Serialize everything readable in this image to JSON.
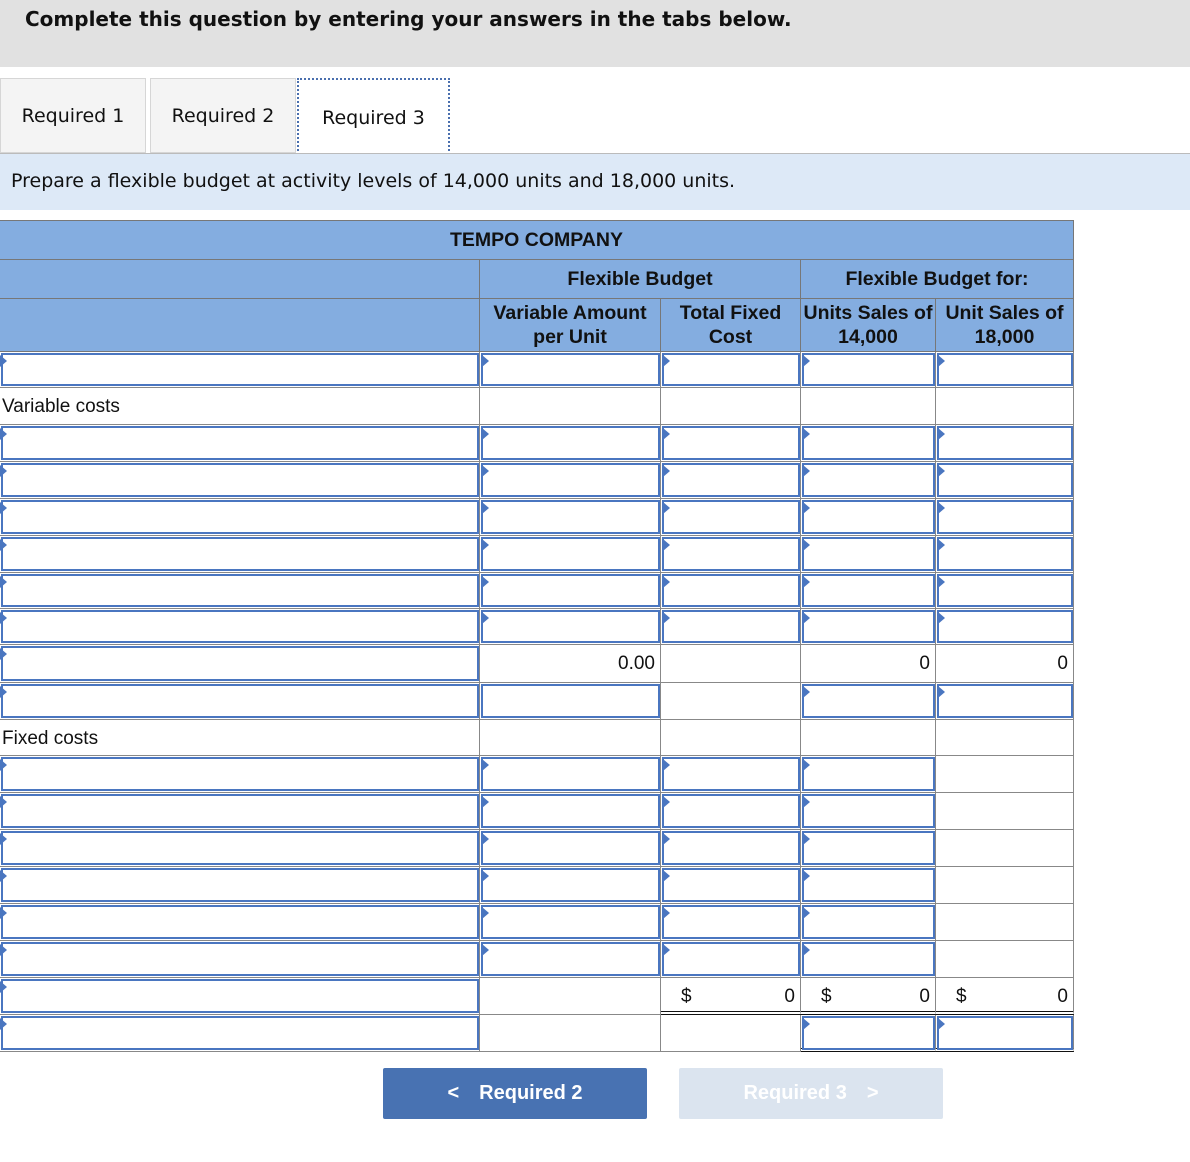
{
  "header": {
    "instruction": "Complete this question by entering your answers in the tabs below."
  },
  "tabs": [
    {
      "label": "Required 1"
    },
    {
      "label": "Required 2"
    },
    {
      "label": "Required 3",
      "active": true
    }
  ],
  "prompt": "Prepare a flexible budget at activity levels of 14,000 units and 18,000 units.",
  "table": {
    "company": "TEMPO COMPANY",
    "group1": "Flexible Budget",
    "group2": "Flexible Budget for:",
    "columns": [
      "Variable Amount per Unit",
      "Total Fixed Cost",
      "Units Sales of 14,000",
      "Unit Sales of 18,000"
    ],
    "rows": [
      {
        "label": {
          "t": "input"
        },
        "cells": [
          {
            "t": "input"
          },
          {
            "t": "input"
          },
          {
            "t": "input"
          },
          {
            "t": "input"
          }
        ]
      },
      {
        "label": {
          "t": "text",
          "v": "Variable costs"
        },
        "cells": [
          {
            "t": "blank"
          },
          {
            "t": "blank"
          },
          {
            "t": "blank"
          },
          {
            "t": "blank"
          }
        ]
      },
      {
        "label": {
          "t": "input"
        },
        "cells": [
          {
            "t": "input"
          },
          {
            "t": "input"
          },
          {
            "t": "input"
          },
          {
            "t": "input"
          }
        ]
      },
      {
        "label": {
          "t": "input"
        },
        "cells": [
          {
            "t": "input"
          },
          {
            "t": "input"
          },
          {
            "t": "input"
          },
          {
            "t": "input"
          }
        ]
      },
      {
        "label": {
          "t": "input"
        },
        "cells": [
          {
            "t": "input"
          },
          {
            "t": "input"
          },
          {
            "t": "input"
          },
          {
            "t": "input"
          }
        ]
      },
      {
        "label": {
          "t": "input"
        },
        "cells": [
          {
            "t": "input"
          },
          {
            "t": "input"
          },
          {
            "t": "input"
          },
          {
            "t": "input"
          }
        ]
      },
      {
        "label": {
          "t": "input"
        },
        "cells": [
          {
            "t": "input"
          },
          {
            "t": "input"
          },
          {
            "t": "input"
          },
          {
            "t": "input"
          }
        ]
      },
      {
        "label": {
          "t": "input"
        },
        "cells": [
          {
            "t": "input"
          },
          {
            "t": "input"
          },
          {
            "t": "input"
          },
          {
            "t": "input"
          }
        ]
      },
      {
        "label": {
          "t": "input"
        },
        "cells": [
          {
            "t": "value",
            "v": "0.00"
          },
          {
            "t": "blank"
          },
          {
            "t": "value",
            "v": "0"
          },
          {
            "t": "value",
            "v": "0"
          }
        ]
      },
      {
        "label": {
          "t": "input"
        },
        "cells": [
          {
            "t": "input",
            "noflag": true
          },
          {
            "t": "blank"
          },
          {
            "t": "input"
          },
          {
            "t": "input"
          }
        ]
      },
      {
        "label": {
          "t": "text",
          "v": "Fixed costs"
        },
        "cells": [
          {
            "t": "blank"
          },
          {
            "t": "blank"
          },
          {
            "t": "blank"
          },
          {
            "t": "blank"
          }
        ]
      },
      {
        "label": {
          "t": "input"
        },
        "cells": [
          {
            "t": "input"
          },
          {
            "t": "input"
          },
          {
            "t": "input"
          },
          {
            "t": "blank"
          }
        ]
      },
      {
        "label": {
          "t": "input"
        },
        "cells": [
          {
            "t": "input"
          },
          {
            "t": "input"
          },
          {
            "t": "input"
          },
          {
            "t": "blank"
          }
        ]
      },
      {
        "label": {
          "t": "input"
        },
        "cells": [
          {
            "t": "input"
          },
          {
            "t": "input"
          },
          {
            "t": "input"
          },
          {
            "t": "blank"
          }
        ]
      },
      {
        "label": {
          "t": "input"
        },
        "cells": [
          {
            "t": "input"
          },
          {
            "t": "input"
          },
          {
            "t": "input"
          },
          {
            "t": "blank"
          }
        ]
      },
      {
        "label": {
          "t": "input"
        },
        "cells": [
          {
            "t": "input"
          },
          {
            "t": "input"
          },
          {
            "t": "input"
          },
          {
            "t": "blank"
          }
        ]
      },
      {
        "label": {
          "t": "input"
        },
        "cells": [
          {
            "t": "input"
          },
          {
            "t": "input"
          },
          {
            "t": "input"
          },
          {
            "t": "blank"
          }
        ]
      },
      {
        "label": {
          "t": "input"
        },
        "cells": [
          {
            "t": "blank"
          },
          {
            "t": "money",
            "v": "0",
            "c": "$"
          },
          {
            "t": "money",
            "v": "0",
            "c": "$"
          },
          {
            "t": "money",
            "v": "0",
            "c": "$"
          }
        ],
        "double": true
      },
      {
        "label": {
          "t": "input"
        },
        "cells": [
          {
            "t": "blank"
          },
          {
            "t": "blank"
          },
          {
            "t": "input"
          },
          {
            "t": "input"
          }
        ],
        "double2": true
      }
    ]
  },
  "nav": {
    "prev_label": "Required 2",
    "next_label": "Required 3",
    "prev_icon": "chevron-left-icon",
    "next_icon": "chevron-right-icon",
    "prev_color": "#4872b2",
    "next_color": "#dbe4ef"
  }
}
